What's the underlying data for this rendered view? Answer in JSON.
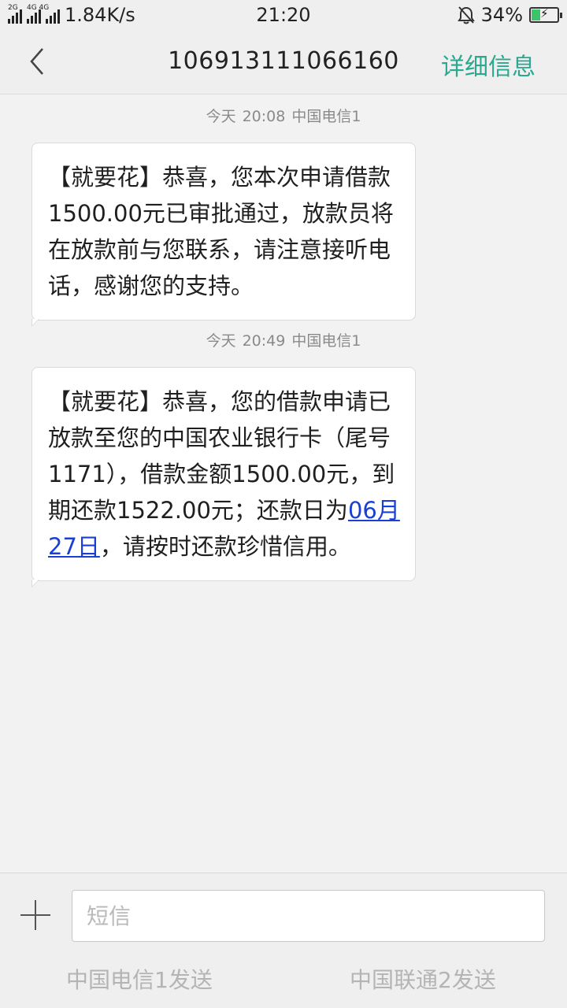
{
  "status_bar": {
    "network_tag_1": "2G",
    "network_tag_2": "4G 4G",
    "speed": "1.84K/s",
    "time": "21:20",
    "battery": "34%",
    "battery_level": 0.34,
    "icons": [
      "signal-icon",
      "signal-icon",
      "alarm-muted-icon",
      "battery-charging-icon"
    ]
  },
  "header": {
    "title": "106913111066160",
    "detail_label": "详细信息",
    "back_icon": "back-chevron-icon"
  },
  "messages": [
    {
      "day": "今天",
      "time": "20:08",
      "sim": "中国电信1",
      "text": "【就要花】恭喜，您本次申请借款1500.00元已审批通过，放款员将在放款前与您联系，请注意接听电话，感谢您的支持。"
    },
    {
      "day": "今天",
      "time": "20:49",
      "sim": "中国电信1",
      "text_before": "【就要花】恭喜，您的借款申请已放款至您的中国农业银行卡（尾号1171），借款金额1500.00元，到期还款1522.00元；还款日为",
      "link": "06月27日",
      "text_after": "，请按时还款珍惜信用。"
    }
  ],
  "composer": {
    "placeholder": "短信",
    "send_sim1": "中国电信1发送",
    "send_sim2": "中国联通2发送"
  },
  "colors": {
    "accent": "#2aa890",
    "link": "#1a3fd6",
    "battery": "#3cc46b"
  }
}
